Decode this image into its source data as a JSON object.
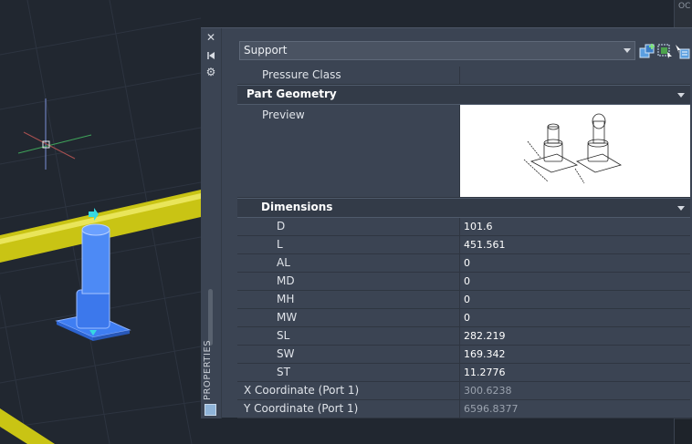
{
  "palette": {
    "title": "PROPERTIES",
    "close_icon": "close-icon",
    "pin_icon": "autohide-icon",
    "settings_icon": "gear-icon"
  },
  "selector": {
    "value": "Support"
  },
  "toolbar": {
    "icons": [
      "toggle-pickadd-icon",
      "select-objects-icon",
      "quick-select-icon"
    ]
  },
  "rows_top": [
    {
      "label": "Pressure Class",
      "value": ""
    }
  ],
  "sections": {
    "part_geometry": "Part Geometry",
    "dimensions": "Dimensions"
  },
  "preview": {
    "label": "Preview"
  },
  "dimensions": [
    {
      "label": "D",
      "value": "101.6"
    },
    {
      "label": "L",
      "value": "451.561"
    },
    {
      "label": "AL",
      "value": "0"
    },
    {
      "label": "MD",
      "value": "0"
    },
    {
      "label": "MH",
      "value": "0"
    },
    {
      "label": "MW",
      "value": "0"
    },
    {
      "label": "SL",
      "value": "282.219"
    },
    {
      "label": "SW",
      "value": "169.342"
    },
    {
      "label": "ST",
      "value": "11.2776"
    }
  ],
  "coordinates": [
    {
      "label": "X Coordinate (Port 1)",
      "value": "300.6238"
    },
    {
      "label": "Y Coordinate (Port 1)",
      "value": "6596.8377"
    }
  ],
  "right_strip": {
    "tag": "OC"
  }
}
